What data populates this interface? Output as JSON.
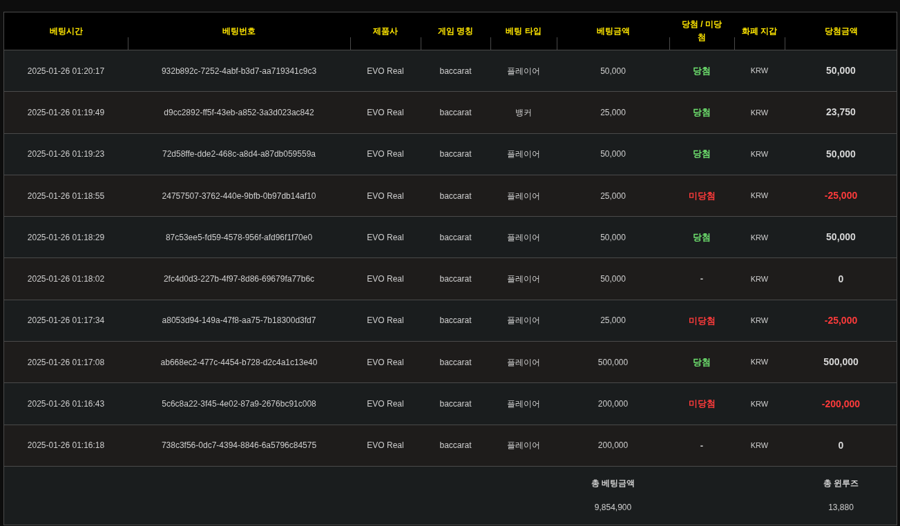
{
  "table": {
    "columns": [
      "베팅시간",
      "베팅번호",
      "제품사",
      "게임 명칭",
      "베팅 타입",
      "베팅금액",
      "당첨 / 미당첨",
      "화폐 지갑",
      "당첨금액"
    ],
    "rows": [
      {
        "time": "2025-01-26 01:20:17",
        "bet_id": "932b892c-7252-4abf-b3d7-aa719341c9c3",
        "provider": "EVO Real",
        "game": "baccarat",
        "bet_type": "플레이어",
        "amount": "50,000",
        "result": {
          "text": "당첨",
          "kind": "win"
        },
        "wallet": "KRW",
        "payout": "50,000"
      },
      {
        "time": "2025-01-26 01:19:49",
        "bet_id": "d9cc2892-ff5f-43eb-a852-3a3d023ac842",
        "provider": "EVO Real",
        "game": "baccarat",
        "bet_type": "뱅커",
        "amount": "25,000",
        "result": {
          "text": "당첨",
          "kind": "win"
        },
        "wallet": "KRW",
        "payout": "23,750"
      },
      {
        "time": "2025-01-26 01:19:23",
        "bet_id": "72d58ffe-dde2-468c-a8d4-a87db059559a",
        "provider": "EVO Real",
        "game": "baccarat",
        "bet_type": "플레이어",
        "amount": "50,000",
        "result": {
          "text": "당첨",
          "kind": "win"
        },
        "wallet": "KRW",
        "payout": "50,000"
      },
      {
        "time": "2025-01-26 01:18:55",
        "bet_id": "24757507-3762-440e-9bfb-0b97db14af10",
        "provider": "EVO Real",
        "game": "baccarat",
        "bet_type": "플레이어",
        "amount": "25,000",
        "result": {
          "text": "미당첨",
          "kind": "lose"
        },
        "wallet": "KRW",
        "payout": "-25,000"
      },
      {
        "time": "2025-01-26 01:18:29",
        "bet_id": "87c53ee5-fd59-4578-956f-afd96f1f70e0",
        "provider": "EVO Real",
        "game": "baccarat",
        "bet_type": "플레이어",
        "amount": "50,000",
        "result": {
          "text": "당첨",
          "kind": "win"
        },
        "wallet": "KRW",
        "payout": "50,000"
      },
      {
        "time": "2025-01-26 01:18:02",
        "bet_id": "2fc4d0d3-227b-4f97-8d86-69679fa77b6c",
        "provider": "EVO Real",
        "game": "baccarat",
        "bet_type": "플레이어",
        "amount": "50,000",
        "result": {
          "text": "-",
          "kind": "none"
        },
        "wallet": "KRW",
        "payout": "0"
      },
      {
        "time": "2025-01-26 01:17:34",
        "bet_id": "a8053d94-149a-47f8-aa75-7b18300d3fd7",
        "provider": "EVO Real",
        "game": "baccarat",
        "bet_type": "플레이어",
        "amount": "25,000",
        "result": {
          "text": "미당첨",
          "kind": "lose"
        },
        "wallet": "KRW",
        "payout": "-25,000"
      },
      {
        "time": "2025-01-26 01:17:08",
        "bet_id": "ab668ec2-477c-4454-b728-d2c4a1c13e40",
        "provider": "EVO Real",
        "game": "baccarat",
        "bet_type": "플레이어",
        "amount": "500,000",
        "result": {
          "text": "당첨",
          "kind": "win"
        },
        "wallet": "KRW",
        "payout": "500,000"
      },
      {
        "time": "2025-01-26 01:16:43",
        "bet_id": "5c6c8a22-3f45-4e02-87a9-2676bc91c008",
        "provider": "EVO Real",
        "game": "baccarat",
        "bet_type": "플레이어",
        "amount": "200,000",
        "result": {
          "text": "미당첨",
          "kind": "lose"
        },
        "wallet": "KRW",
        "payout": "-200,000"
      },
      {
        "time": "2025-01-26 01:16:18",
        "bet_id": "738c3f56-0dc7-4394-8846-6a5796c84575",
        "provider": "EVO Real",
        "game": "baccarat",
        "bet_type": "플레이어",
        "amount": "200,000",
        "result": {
          "text": "-",
          "kind": "none"
        },
        "wallet": "KRW",
        "payout": "0"
      }
    ],
    "totals": {
      "bet_label": "총 베팅금액",
      "bet_value": "9,854,900",
      "winloss_label": "총 윈루즈",
      "winloss_value": "13,880"
    }
  }
}
